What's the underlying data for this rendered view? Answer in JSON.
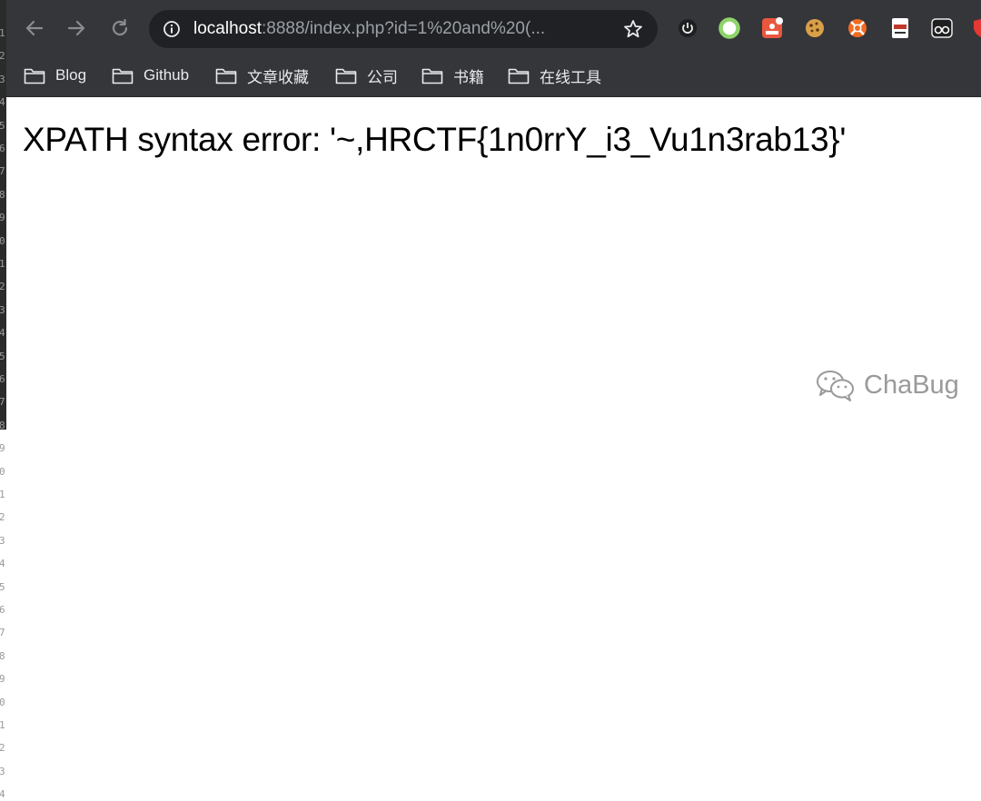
{
  "editor_gutter": {
    "line_numbers": [
      "1",
      "2",
      "3",
      "4",
      "5",
      "6",
      "7",
      "8",
      "9",
      "0",
      "1",
      "2",
      "3",
      "4",
      "5",
      "6",
      "7",
      "8",
      "9",
      "0",
      "1",
      "2",
      "3",
      "4",
      "5",
      "6",
      "7",
      "8",
      "9",
      "0",
      "1",
      "2",
      "3",
      "4"
    ]
  },
  "browser": {
    "nav": {
      "back_icon": "arrow-left",
      "forward_icon": "arrow-right",
      "reload_icon": "reload"
    },
    "omnibox": {
      "host": "localhost",
      "path": ":8888/index.php?id=1%20and%20(...",
      "info_icon": "info-circle",
      "bookmark_star_icon": "star-outline"
    },
    "extensions": [
      "power-icon",
      "green-ring-icon",
      "red-badge-icon",
      "cookie-icon",
      "orange-lifebuoy-icon",
      "pdf-doc-icon",
      "glasses-icon",
      "red-shield-icon"
    ]
  },
  "bookmarks": [
    {
      "label": "Blog"
    },
    {
      "label": "Github"
    },
    {
      "label": "文章收藏"
    },
    {
      "label": "公司"
    },
    {
      "label": "书籍"
    },
    {
      "label": "在线工具"
    }
  ],
  "page": {
    "error_message": "XPATH syntax error: '~,HRCTF{1n0rrY_i3_Vu1n3rab13}'"
  },
  "watermark": {
    "text": "ChaBug",
    "icon": "wechat-icon"
  },
  "colors": {
    "toolbar_bg": "#35363a",
    "omnibox_bg": "#202124",
    "page_bg": "#ffffff",
    "text": "#000000",
    "muted_url": "#9aa0a6"
  }
}
